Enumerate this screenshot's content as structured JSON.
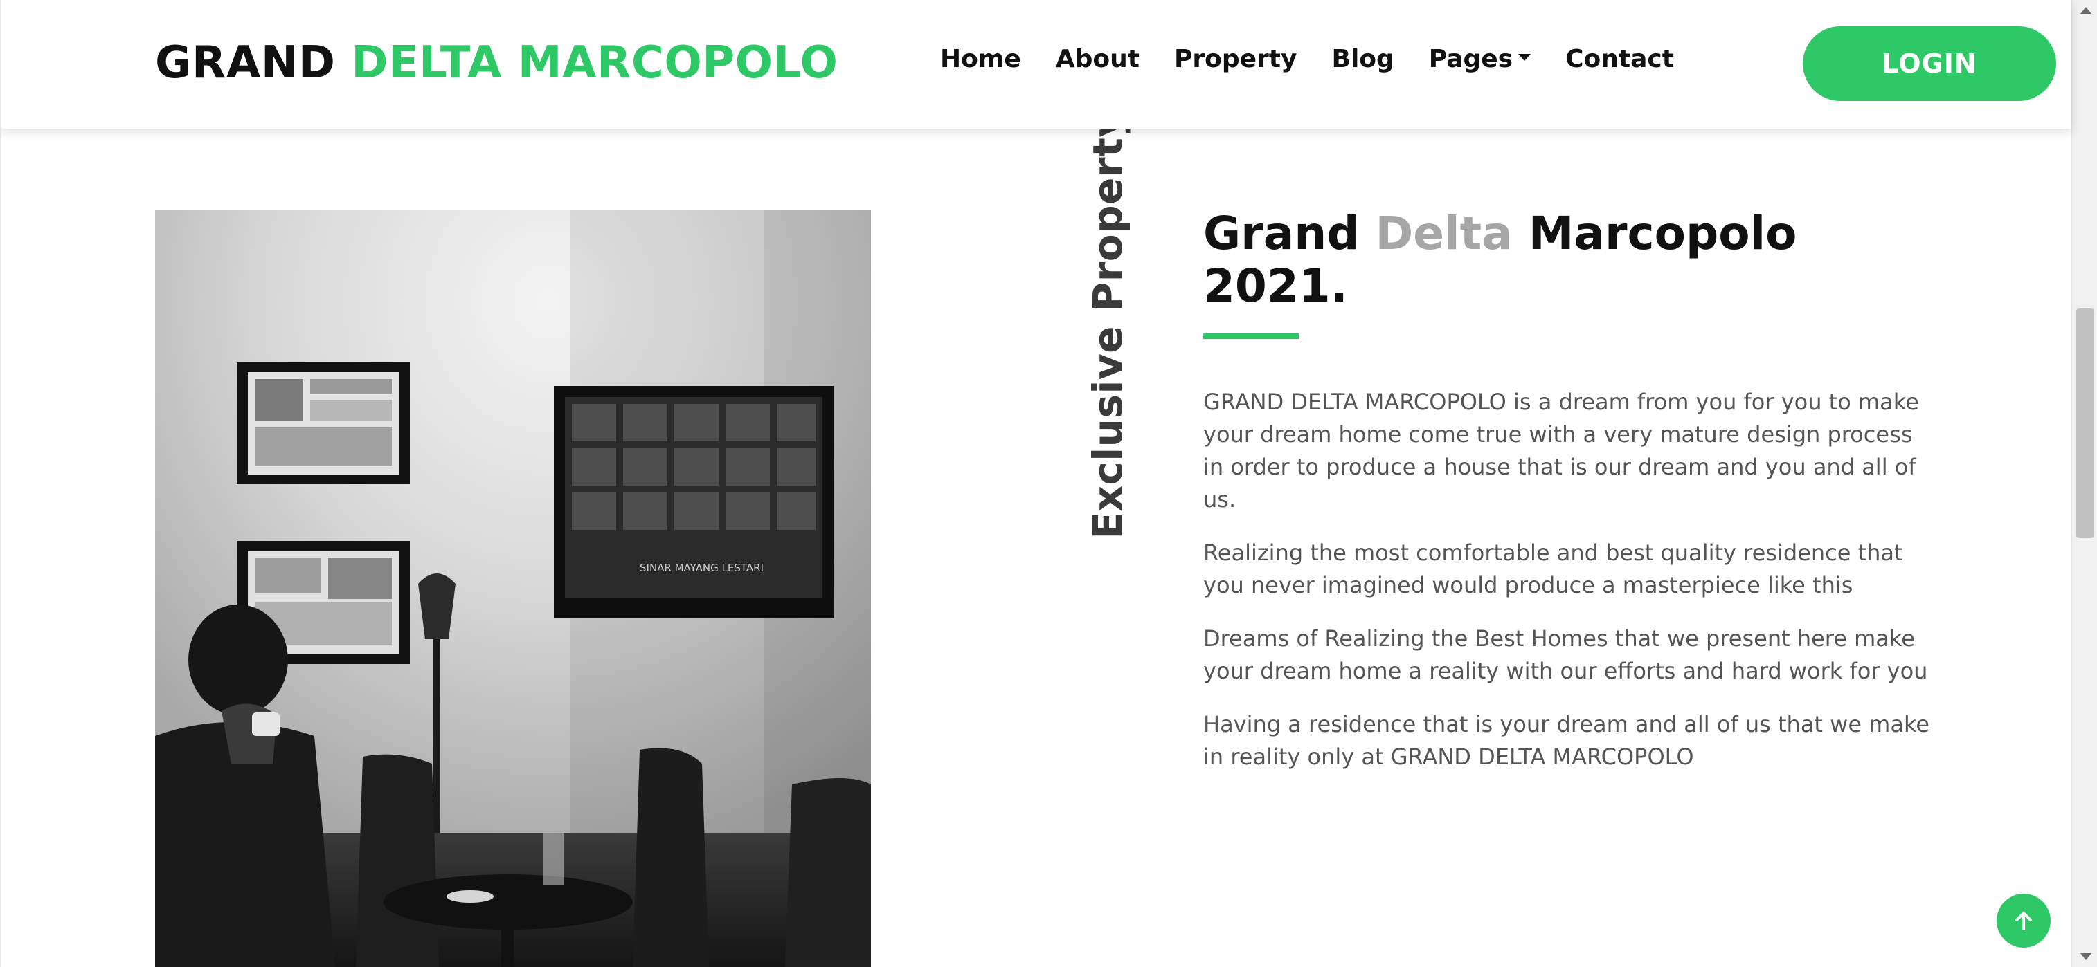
{
  "brand": {
    "part1": "GRAND",
    "part2": "DELTA MARCOPOLO"
  },
  "nav": {
    "items": [
      "Home",
      "About",
      "Property",
      "Blog",
      "Pages",
      "Contact"
    ]
  },
  "login_label": "LOGIN",
  "section": {
    "vertical_label": "Exclusive Property",
    "heading_part1": "Grand",
    "heading_part2": "Delta",
    "heading_part3": "Marcopolo",
    "heading_line2": "2021.",
    "paragraphs": [
      "GRAND DELTA MARCOPOLO is a dream from you for you to make your dream home come true with a very mature design process in order to produce a house that is our dream and you and all of us.",
      "Realizing the most comfortable and best quality residence that you never imagined would produce a masterpiece like this",
      "Dreams of Realizing the Best Homes that we present here make your dream home a reality with our efforts and hard work for you",
      "Having a residence that is your dream and all of us that we make in reality only at GRAND DELTA MARCOPOLO"
    ]
  },
  "photo": {
    "frame_caption": "SINAR MAYANG LESTARI"
  },
  "colors": {
    "accent": "#2ec866",
    "muted": "#a6a6a6",
    "text": "#111111",
    "body_text": "#555555"
  },
  "icons": {
    "dropdown": "caret-down-icon",
    "back_to_top": "arrow-up-icon"
  }
}
